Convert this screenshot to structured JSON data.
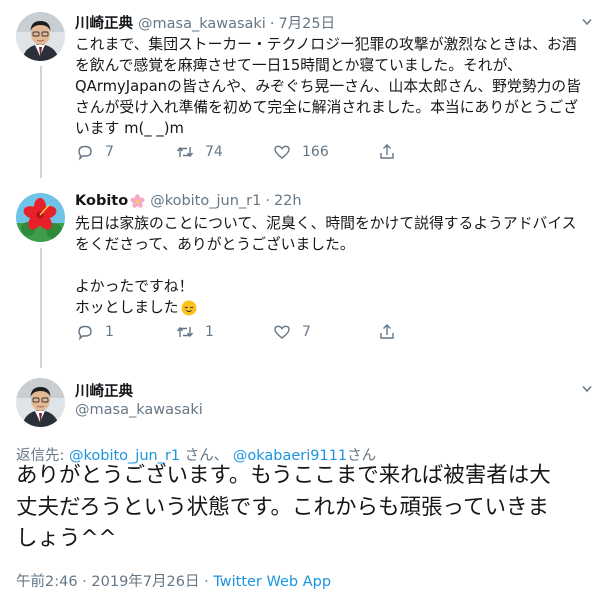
{
  "tweet1": {
    "display_name": "川崎正典",
    "handle": "@masa_kawasaki",
    "separator": "·",
    "time": "7月25日",
    "lines": [
      "これまで、集団ストーカー・テクノロジー犯罪の攻撃が激烈なときは、お酒",
      "を飲んで感覚を麻痺させて一日15時間とか寝ていました。それが、",
      "QArmyJapanの皆さんや、みぞぐち晃一さん、山本太郎さん、野党勢力の皆",
      "さんが受け入れ準備を初めて完全に解消されました。本当にありがとうござ",
      "います m(_ _)m"
    ],
    "reply_count": "7",
    "retweet_count": "74",
    "like_count": "166"
  },
  "tweet2": {
    "display_name": "Kobito",
    "name_emoji": "flower-icon",
    "handle": "@kobito_jun_r1",
    "separator": "·",
    "time": "22h",
    "lines": [
      "先日は家族のことについて、泥臭く、時間をかけて説得するようアドバイス",
      "をくださって、ありがとうございました。",
      "",
      "よかったですね！",
      "ホッとしました"
    ],
    "trailing_emoji": "relieved-face-icon",
    "reply_count": "1",
    "retweet_count": "1",
    "like_count": "7"
  },
  "main_tweet": {
    "display_name": "川崎正典",
    "handle": "@masa_kawasaki",
    "reply_label": "返信先: ",
    "reply_user1": "@kobito_jun_r1",
    "reply_san1": " さん、 ",
    "reply_user2": "@okabaeri9111",
    "reply_san2": "さん",
    "lines": [
      "ありがとうございます。もうここまで来れば被害者は大",
      "丈夫だろうという状態です。これからも頑張っていきま",
      "しょう^^"
    ],
    "timestamp": "午前2:46 · 2019年7月26日 · ",
    "client": "Twitter Web App"
  },
  "colors": {
    "text": "#14171a",
    "muted": "#657786",
    "link": "#1b95e0",
    "thread_line": "#ccd6dd"
  }
}
